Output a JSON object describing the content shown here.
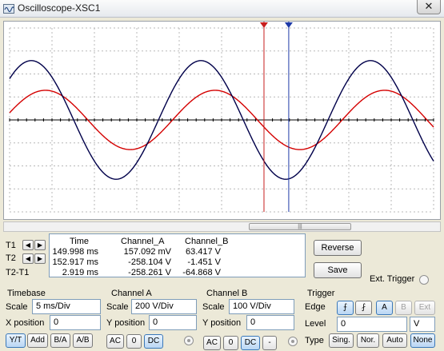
{
  "window": {
    "title": "Oscilloscope-XSC1",
    "close_glyph": "✕"
  },
  "display": {
    "background": "#ffffff",
    "grid_color": "#b8b8b8",
    "axis_color": "#000000",
    "channel_a_color": "#d40000",
    "channel_b_color": "#00004a",
    "cursor_t1_color": "#c81e1e",
    "cursor_t2_color": "#1e3aa8",
    "divisions": {
      "x": 10,
      "y": 8
    },
    "timebase_ms_per_div": 5,
    "channel_a_volts_per_div": 200,
    "channel_b_volts_per_div": 100,
    "time_start_ms": 120,
    "channel_a": {
      "amplitude_v": 258,
      "period_ms": 20,
      "phase_deg": 14
    },
    "channel_b": {
      "amplitude_v": 258,
      "period_ms": 20,
      "phase_deg": 44
    },
    "cursors": {
      "t1_ms": 149.998,
      "t2_ms": 152.917
    },
    "scroll_thumb_glyph": "|||"
  },
  "cursors_panel": {
    "t1_label": "T1",
    "t2_label": "T2",
    "diff_label": "T2-T1",
    "left_arrow": "◀",
    "right_arrow": "▶"
  },
  "readout": {
    "headers": {
      "time": "Time",
      "channel_a": "Channel_A",
      "channel_b": "Channel_B"
    },
    "rows": [
      {
        "time": "149.998 ms",
        "channel_a": "157.092 mV",
        "channel_b": "63.417 V"
      },
      {
        "time": "152.917 ms",
        "channel_a": "-258.104 V",
        "channel_b": "-1.451 V"
      },
      {
        "time": "2.919 ms",
        "channel_a": "-258.261 V",
        "channel_b": "-64.868 V"
      }
    ]
  },
  "buttons": {
    "reverse": "Reverse",
    "save": "Save",
    "ext_trigger": "Ext. Trigger"
  },
  "timebase": {
    "title": "Timebase",
    "scale_label": "Scale",
    "scale_value": "5 ms/Div",
    "xpos_label": "X position",
    "xpos_value": "0",
    "modes": [
      "Y/T",
      "Add",
      "B/A",
      "A/B"
    ]
  },
  "channel_a": {
    "title": "Channel A",
    "scale_label": "Scale",
    "scale_value": "200  V/Div",
    "ypos_label": "Y position",
    "ypos_value": "0",
    "coupling": [
      "AC",
      "0",
      "DC"
    ]
  },
  "channel_b": {
    "title": "Channel B",
    "scale_label": "Scale",
    "scale_value": "100  V/Div",
    "ypos_label": "Y position",
    "ypos_value": "0",
    "coupling": [
      "AC",
      "0",
      "DC",
      "-"
    ]
  },
  "trigger": {
    "title": "Trigger",
    "edge_label": "Edge",
    "rising": "⨍",
    "falling": "⨏",
    "source_a": "A",
    "source_b": "B",
    "source_ext": "Ext",
    "level_label": "Level",
    "level_value": "0",
    "level_unit": "V",
    "type_label": "Type",
    "types": [
      "Sing.",
      "Nor.",
      "Auto",
      "None"
    ]
  }
}
